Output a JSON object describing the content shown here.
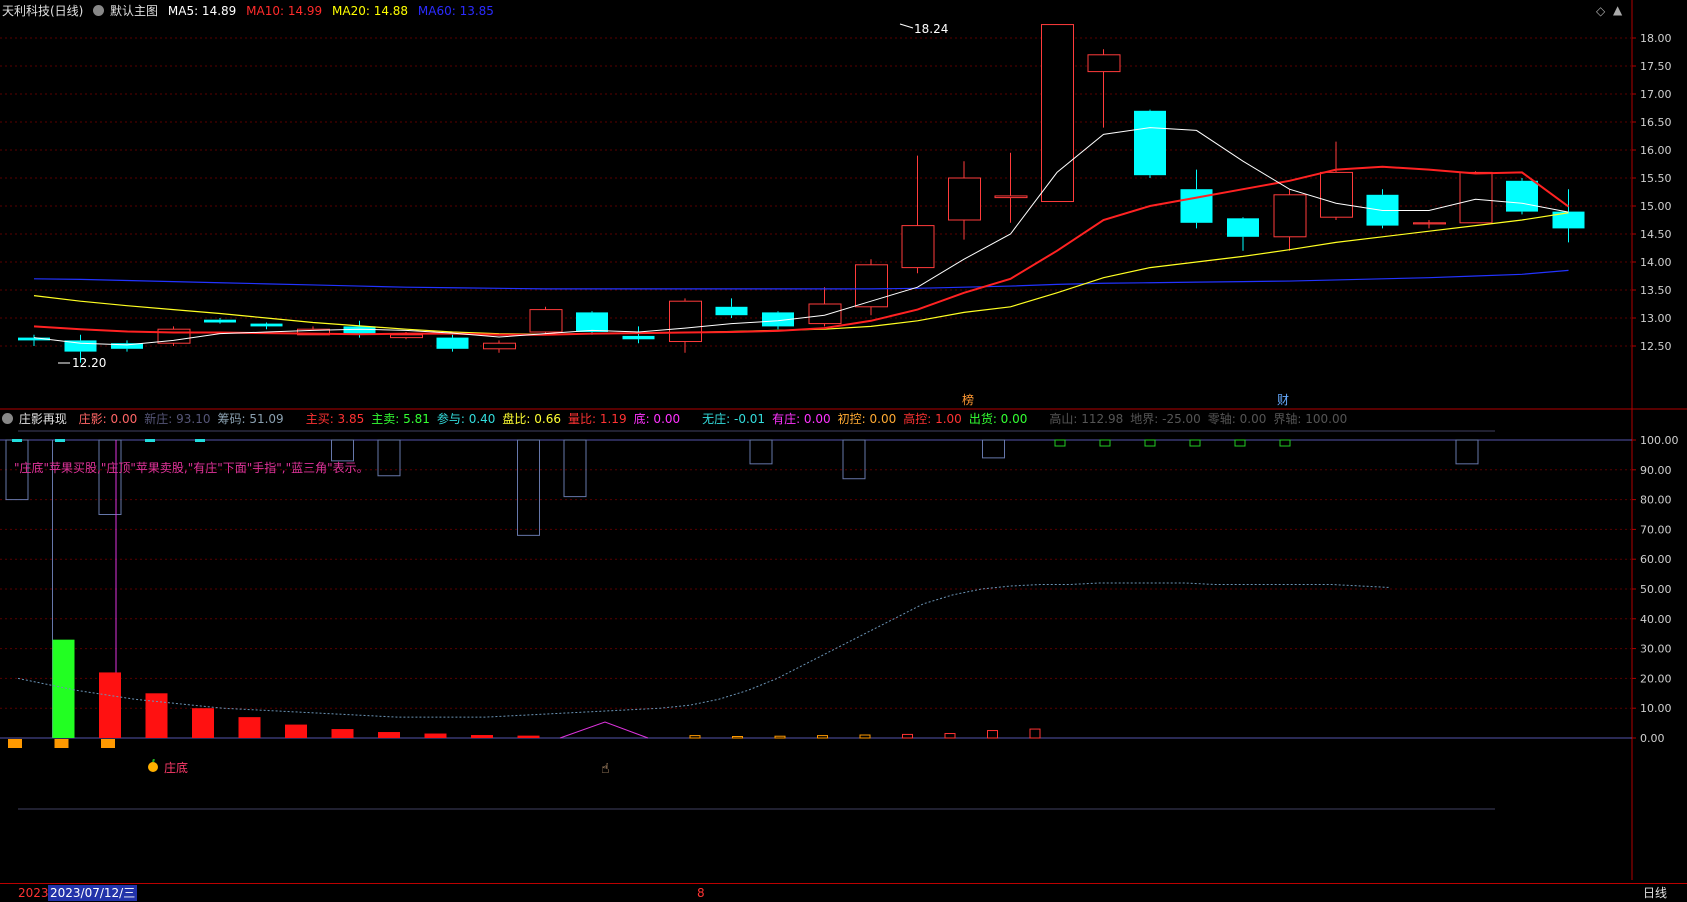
{
  "top_header": {
    "stock_title": "天利科技(日线)",
    "template_label": "默认主图",
    "ma5": "MA5: 14.89",
    "ma10": "MA10: 14.99",
    "ma20": "MA20: 14.88",
    "ma60": "MA60: 13.85",
    "colors": {
      "ma5": "#ffffff",
      "ma10": "#ff2b2b",
      "ma20": "#ffff00",
      "ma60": "#2222ff"
    }
  },
  "price_axis": [
    "18.00",
    "17.50",
    "17.00",
    "16.50",
    "16.00",
    "15.50",
    "15.00",
    "14.50",
    "14.00",
    "13.50",
    "13.00",
    "12.50"
  ],
  "price_annotations": {
    "high": "18.24",
    "low": "12.20",
    "mark_left": "榜",
    "mark_right": "财"
  },
  "candles": [
    {
      "o": 12.65,
      "c": 12.6,
      "h": 12.7,
      "l": 12.5
    },
    {
      "o": 12.6,
      "c": 12.4,
      "h": 12.7,
      "l": 12.2
    },
    {
      "o": 12.55,
      "c": 12.45,
      "h": 12.6,
      "l": 12.4
    },
    {
      "o": 12.55,
      "c": 12.8,
      "h": 12.85,
      "l": 12.5
    },
    {
      "o": 12.97,
      "c": 12.92,
      "h": 13.0,
      "l": 12.9
    },
    {
      "o": 12.9,
      "c": 12.85,
      "h": 12.92,
      "l": 12.8
    },
    {
      "o": 12.7,
      "c": 12.8,
      "h": 12.85,
      "l": 12.7
    },
    {
      "o": 12.85,
      "c": 12.7,
      "h": 12.95,
      "l": 12.65
    },
    {
      "o": 12.65,
      "c": 12.7,
      "h": 12.75,
      "l": 12.62
    },
    {
      "o": 12.65,
      "c": 12.45,
      "h": 12.7,
      "l": 12.4
    },
    {
      "o": 12.45,
      "c": 12.55,
      "h": 12.6,
      "l": 12.38
    },
    {
      "o": 12.75,
      "c": 13.15,
      "h": 13.2,
      "l": 12.7
    },
    {
      "o": 13.1,
      "c": 12.75,
      "h": 13.12,
      "l": 12.7
    },
    {
      "o": 12.68,
      "c": 12.62,
      "h": 12.85,
      "l": 12.55
    },
    {
      "o": 12.58,
      "c": 13.3,
      "h": 13.35,
      "l": 12.38
    },
    {
      "o": 13.2,
      "c": 13.05,
      "h": 13.35,
      "l": 13.0
    },
    {
      "o": 13.1,
      "c": 12.85,
      "h": 13.12,
      "l": 12.8
    },
    {
      "o": 12.9,
      "c": 13.25,
      "h": 13.55,
      "l": 12.85
    },
    {
      "o": 13.2,
      "c": 13.95,
      "h": 14.05,
      "l": 13.05
    },
    {
      "o": 13.9,
      "c": 14.65,
      "h": 15.9,
      "l": 13.8
    },
    {
      "o": 14.75,
      "c": 15.5,
      "h": 15.8,
      "l": 14.4
    },
    {
      "o": 15.15,
      "c": 15.18,
      "h": 15.95,
      "l": 14.7
    },
    {
      "o": 15.08,
      "c": 18.24,
      "h": 18.24,
      "l": 15.08
    },
    {
      "o": 17.4,
      "c": 17.7,
      "h": 17.8,
      "l": 16.4
    },
    {
      "o": 16.7,
      "c": 15.55,
      "h": 16.72,
      "l": 15.5
    },
    {
      "o": 15.3,
      "c": 14.7,
      "h": 15.65,
      "l": 14.6
    },
    {
      "o": 14.78,
      "c": 14.45,
      "h": 14.8,
      "l": 14.2
    },
    {
      "o": 14.45,
      "c": 15.2,
      "h": 15.3,
      "l": 14.2
    },
    {
      "o": 14.8,
      "c": 15.6,
      "h": 16.15,
      "l": 14.75
    },
    {
      "o": 15.2,
      "c": 14.65,
      "h": 15.3,
      "l": 14.6
    },
    {
      "o": 14.68,
      "c": 14.7,
      "h": 14.75,
      "l": 14.6
    },
    {
      "o": 14.7,
      "c": 15.6,
      "h": 15.62,
      "l": 14.7
    },
    {
      "o": 15.45,
      "c": 14.9,
      "h": 15.5,
      "l": 14.85
    },
    {
      "o": 14.9,
      "c": 14.6,
      "h": 15.3,
      "l": 14.35
    }
  ],
  "ma_lines": {
    "ma5": [
      12.65,
      12.55,
      12.52,
      12.6,
      12.72,
      12.75,
      12.78,
      12.8,
      12.78,
      12.73,
      12.66,
      12.72,
      12.78,
      12.75,
      12.82,
      12.9,
      12.95,
      13.05,
      13.3,
      13.55,
      14.05,
      14.5,
      15.6,
      16.28,
      16.4,
      16.35,
      15.8,
      15.3,
      15.05,
      14.92,
      14.92,
      15.12,
      15.05,
      14.89
    ],
    "ma10": [
      12.85,
      12.8,
      12.76,
      12.74,
      12.74,
      12.73,
      12.72,
      12.71,
      12.72,
      12.72,
      12.7,
      12.7,
      12.72,
      12.73,
      12.74,
      12.75,
      12.77,
      12.82,
      12.95,
      13.15,
      13.45,
      13.7,
      14.2,
      14.75,
      15.0,
      15.15,
      15.3,
      15.45,
      15.65,
      15.7,
      15.65,
      15.58,
      15.6,
      14.99
    ],
    "ma20": [
      13.4,
      13.3,
      13.22,
      13.15,
      13.08,
      13.0,
      12.92,
      12.86,
      12.8,
      12.75,
      12.72,
      12.71,
      12.72,
      12.73,
      12.74,
      12.76,
      12.78,
      12.8,
      12.85,
      12.95,
      13.1,
      13.2,
      13.45,
      13.72,
      13.9,
      14.0,
      14.1,
      14.22,
      14.35,
      14.45,
      14.55,
      14.65,
      14.75,
      14.88
    ],
    "ma60": [
      13.7,
      13.69,
      13.67,
      13.65,
      13.63,
      13.61,
      13.59,
      13.57,
      13.55,
      13.54,
      13.53,
      13.52,
      13.52,
      13.52,
      13.52,
      13.52,
      13.52,
      13.52,
      13.52,
      13.53,
      13.55,
      13.57,
      13.6,
      13.62,
      13.63,
      13.64,
      13.65,
      13.66,
      13.68,
      13.7,
      13.72,
      13.75,
      13.78,
      13.85
    ]
  },
  "bottom_header": {
    "indicator_name": "庄影再现",
    "items": [
      {
        "text": "庄影: 0.00",
        "color": "#ff6666"
      },
      {
        "text": "新庄: 93.10",
        "color": "#555577"
      },
      {
        "text": "筹码: 51.09",
        "color": "#8aa0b0"
      },
      {
        "text": "主买: 3.85",
        "color": "#ff3333"
      },
      {
        "text": "主卖: 5.81",
        "color": "#33ff33"
      },
      {
        "text": "参与: 0.40",
        "color": "#33dddd"
      },
      {
        "text": "盘比: 0.66",
        "color": "#ffff33"
      },
      {
        "text": "量比: 1.19",
        "color": "#ff3333"
      },
      {
        "text": "底: 0.00",
        "color": "#ff33ff"
      },
      {
        "text": "无庄: -0.01",
        "color": "#33dddd"
      },
      {
        "text": "有庄: 0.00",
        "color": "#ff33ff"
      },
      {
        "text": "初控: 0.00",
        "color": "#ffaa33"
      },
      {
        "text": "高控: 1.00",
        "color": "#ff3333"
      },
      {
        "text": "出货: 0.00",
        "color": "#33ff33"
      },
      {
        "text": "高山: 112.98",
        "color": "#555555"
      },
      {
        "text": "地界: -25.00",
        "color": "#555555"
      },
      {
        "text": "零轴: 0.00",
        "color": "#555555"
      },
      {
        "text": "界轴: 100.00",
        "color": "#555555"
      }
    ]
  },
  "indicator_axis": [
    "100.00",
    "90.00",
    "80.00",
    "70.00",
    "60.00",
    "50.00",
    "40.00",
    "30.00",
    "20.00",
    "10.00",
    "0.00"
  ],
  "indicator_note": "\"庄底\"苹果买股,\"庄顶\"苹果卖股,\"有庄\"下面\"手指\",\"蓝三角\"表示。",
  "zhuangdi_label": "庄底",
  "red_bars": [
    0,
    0,
    22,
    15,
    10,
    7,
    4.5,
    3,
    2,
    1.5,
    1,
    0.8,
    0,
    0,
    0,
    0
  ],
  "green_bar": {
    "index": 1,
    "value": 33
  },
  "chip_line": [
    20,
    18,
    16,
    14.5,
    13,
    12,
    11,
    10,
    9.5,
    9,
    8.5,
    8,
    7.5,
    7,
    7,
    7,
    7,
    7.5,
    8,
    8.5,
    9,
    9.5,
    10,
    11,
    13,
    16,
    20,
    25,
    30,
    35,
    40,
    45,
    48,
    50,
    51,
    51.5,
    51.5,
    52,
    52,
    52,
    52,
    51.5,
    51.5,
    51.5,
    51.5,
    51.5,
    51,
    50.5
  ],
  "status": {
    "year": "2023",
    "date": "2023/07/12/三",
    "mid_mark": "8",
    "period": "日线"
  }
}
